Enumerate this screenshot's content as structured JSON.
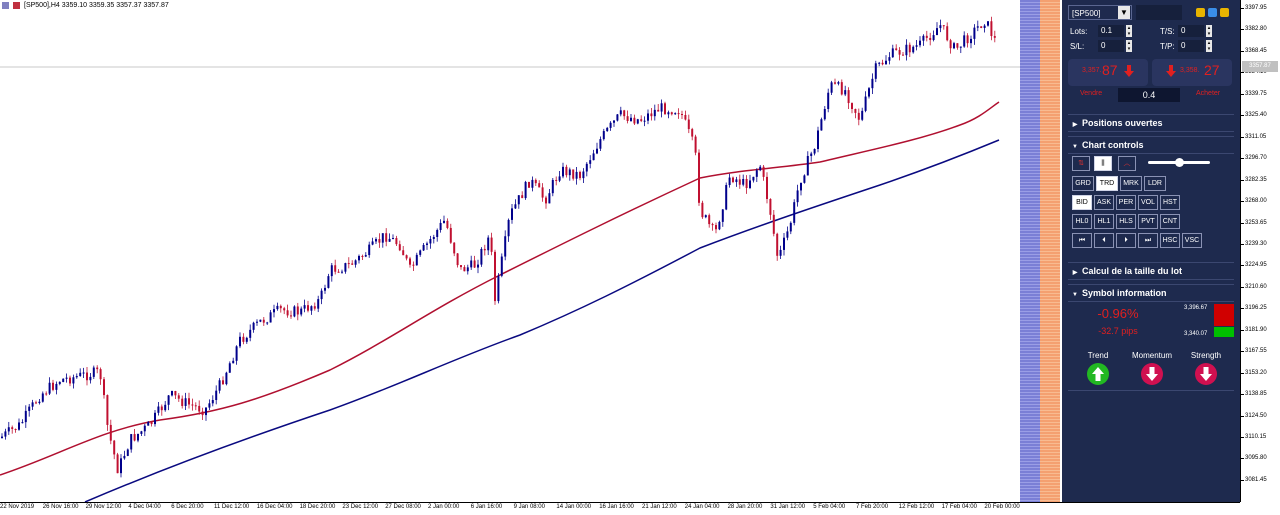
{
  "chart": {
    "header_text": "[SP500],H4  3359.10 3359.35 3357.37 3357.87",
    "current_price": "3357.87",
    "price_ticks": [
      "3397.95",
      "3382.80",
      "3368.45",
      "3354.10",
      "3339.75",
      "3325.40",
      "3311.05",
      "3296.70",
      "3282.35",
      "3268.00",
      "3253.65",
      "3239.30",
      "3224.95",
      "3210.60",
      "3196.25",
      "3181.90",
      "3167.55",
      "3153.20",
      "3138.85",
      "3124.50",
      "3110.15",
      "3095.80",
      "3081.45"
    ],
    "time_ticks": [
      "22 Nov 2019",
      "26 Nov 16:00",
      "29 Nov 12:00",
      "4 Dec 04:00",
      "6 Dec 20:00",
      "11 Dec 12:00",
      "16 Dec 04:00",
      "18 Dec 20:00",
      "23 Dec 12:00",
      "27 Dec 08:00",
      "2 Jan 00:00",
      "6 Jan 16:00",
      "9 Jan 08:00",
      "14 Jan 00:00",
      "16 Jan 16:00",
      "21 Jan 12:00",
      "24 Jan 04:00",
      "28 Jan 20:00",
      "31 Jan 12:00",
      "5 Feb 04:00",
      "7 Feb 20:00",
      "12 Feb 12:00",
      "17 Feb 04:00",
      "20 Feb 00:00"
    ],
    "colors": {
      "bull": "#00008b",
      "bear": "#c01030",
      "ma_fast": "#b01030",
      "ma_slow": "#0a0a80"
    }
  },
  "panel": {
    "symbol": "[SP500]",
    "lots_label": "Lots:",
    "lots_value": "0.1",
    "ts_label": "T/S:",
    "ts_value": "0",
    "sl_label": "S/L:",
    "sl_value": "0",
    "tp_label": "T/P:",
    "tp_value": "0",
    "sell_price_small": "3,357.",
    "sell_price_big": "87",
    "buy_price_small": "3,358.",
    "buy_price_big": "27",
    "sell_label": "Vendre",
    "buy_label": "Acheter",
    "lot_size": "0.4",
    "sections": {
      "positions": "Positions ouvertes",
      "chart_controls": "Chart controls",
      "lot_calc": "Calcul de la taille du lot",
      "symbol_info": "Symbol information"
    },
    "controls": {
      "row1": [
        "GRD",
        "TRD",
        "MRK",
        "LDR"
      ],
      "row2": [
        "BID",
        "ASK",
        "PER",
        "VOL",
        "HST"
      ],
      "row3": [
        "HL0",
        "HL1",
        "HLS",
        "PVT",
        "CNT"
      ],
      "row4": [
        "⏮",
        "⏴",
        "⏵",
        "⏭",
        "HSC",
        "VSC"
      ]
    },
    "slider_value": 0.5,
    "symbol_info": {
      "pct_change": "-0.96%",
      "pips": "-32.7 pips",
      "high": "3,396.67",
      "low": "3,340.07",
      "trend_label": "Trend",
      "momentum_label": "Momentum",
      "strength_label": "Strength",
      "trend_icon": "up-arrow-icon",
      "momentum_icon": "down-arrow-icon",
      "strength_icon": "down-arrow-icon"
    }
  }
}
